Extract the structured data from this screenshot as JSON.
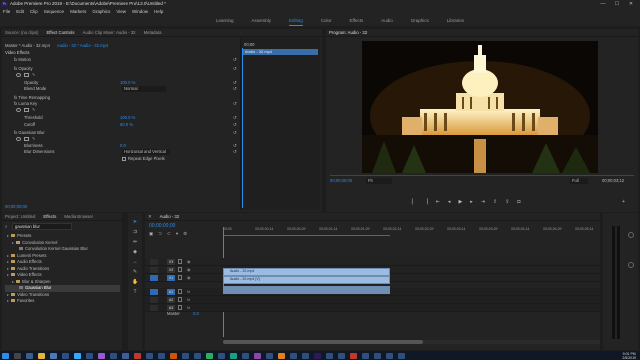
{
  "window": {
    "title": "Adobe Premiere Pro 2019 - E:\\Documents\\Adobe\\Premiere Pro\\13.0\\Untitled *",
    "logo": "Pr",
    "controls": [
      "—",
      "☐",
      "✕"
    ]
  },
  "menu": [
    "File",
    "Edit",
    "Clip",
    "Sequence",
    "Markers",
    "Graphics",
    "View",
    "Window",
    "Help"
  ],
  "workspaces": {
    "items": [
      "Learning",
      "Assembly",
      "Editing",
      "Color",
      "Effects",
      "Audio",
      "Graphics",
      "Libraries"
    ],
    "active": "Editing"
  },
  "effect_controls": {
    "tabs": [
      "Source: (no clips)",
      "Effect Controls",
      "Audio Clip Mixer: Audio - 32",
      "Metadata"
    ],
    "active_tab": "Effect Controls",
    "breadcrumb_master": "Master * Audio - 32.mp4",
    "breadcrumb_seq": "Audio - 32 * Audio - 32.mp4",
    "section_title": "Video Effects",
    "mini_timecode": "00;00",
    "mini_clip": "Audio - 32.mp4",
    "rows": [
      {
        "label": "fx  Motion",
        "value": ""
      },
      {
        "label": "fx  Opacity",
        "value": ""
      },
      {
        "label": "",
        "value": ""
      },
      {
        "label": "Opacity",
        "value": "100.0 %"
      },
      {
        "label": "Blend Mode",
        "value": "Normal"
      },
      {
        "label": "fx  Time Remapping",
        "value": ""
      },
      {
        "label": "fx  Luma Key",
        "value": ""
      },
      {
        "label": "",
        "value": ""
      },
      {
        "label": "Threshold",
        "value": "100.0 %"
      },
      {
        "label": "Cutoff",
        "value": "60.0 %"
      },
      {
        "label": "fx  Gaussian Blur",
        "value": ""
      },
      {
        "label": "",
        "value": ""
      },
      {
        "label": "Blurriness",
        "value": "0.0"
      },
      {
        "label": "Blur Dimensions",
        "value": "Horizontal and Vertical"
      },
      {
        "label": "",
        "value": "Repeat Edge Pixels"
      }
    ],
    "footer_timecode": "00;00;00;00"
  },
  "program_monitor": {
    "title": "Program: Audio - 32",
    "timecode": "00;00;00;00",
    "fit": "Fit",
    "quality": "Full",
    "duration": "00;00;03;12"
  },
  "project": {
    "tabs": [
      "Project: Untitled",
      "Effects",
      "Media Browser"
    ],
    "active_tab": "Effects",
    "search": "gaussian blur",
    "tree": [
      {
        "label": "Presets",
        "level": 0
      },
      {
        "label": "Convolution Kernel",
        "level": 1
      },
      {
        "label": "Convolution Kernel Gaussian Blur",
        "level": 2
      },
      {
        "label": "Lumetri Presets",
        "level": 0
      },
      {
        "label": "Audio Effects",
        "level": 0
      },
      {
        "label": "Audio Transitions",
        "level": 0
      },
      {
        "label": "Video Effects",
        "level": 0
      },
      {
        "label": "Blur & Sharpen",
        "level": 1
      },
      {
        "label": "Gaussian Blur",
        "level": 2,
        "selected": true
      },
      {
        "label": "Video Transitions",
        "level": 0
      },
      {
        "label": "Favorites",
        "level": 0
      }
    ]
  },
  "timeline": {
    "tab": "Audio - 32",
    "timecode": "00;00;00;00",
    "ruler": [
      "00;00",
      "00;00;00;14",
      "00;00;00;29",
      "00;00;01;14",
      "00;00;01;29",
      "00;00;02;14",
      "00;00;02;29",
      "00;00;03;14",
      "00;00;03;29",
      "00;00;04;14",
      "00;00;04;29",
      "00;00;05;14"
    ],
    "tracks": [
      "V3",
      "V2",
      "V1",
      "A1",
      "A2",
      "A3"
    ],
    "master_label": "Master",
    "master_value": "0.0",
    "clips": {
      "v2": "Audio - 32.mp4",
      "v1": "Audio - 32.mp4 [V]"
    }
  },
  "taskbar": {
    "time": "9:01 PM",
    "date": "2/5/2019"
  }
}
